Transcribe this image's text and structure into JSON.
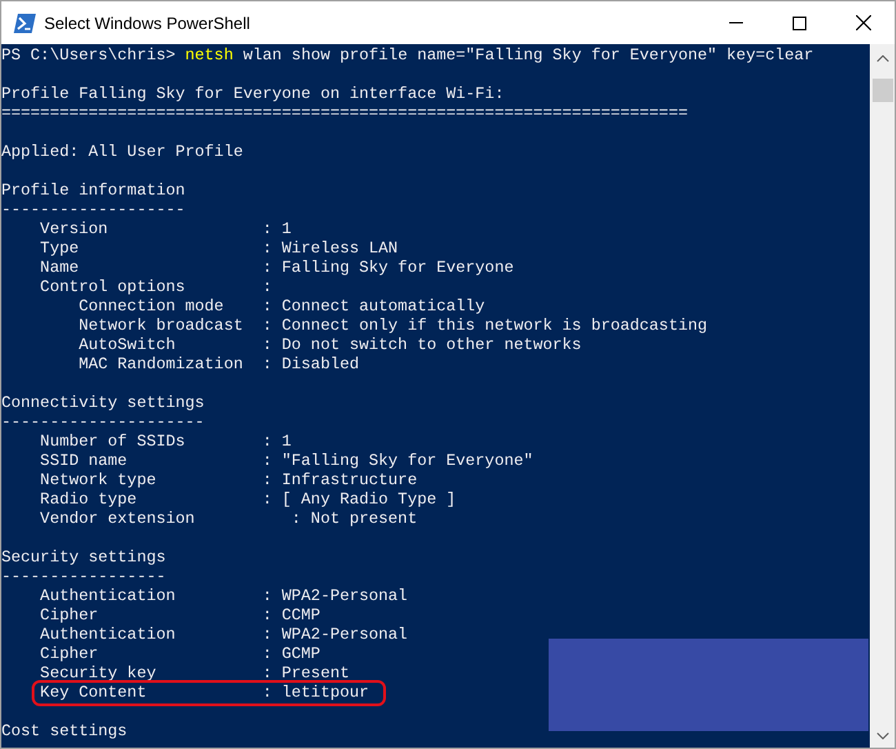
{
  "window": {
    "title": "Select Windows PowerShell"
  },
  "console": {
    "lines": [
      {
        "kind": "prompt",
        "prompt": "PS C:\\Users\\chris> ",
        "command": "netsh",
        "args": " wlan show profile name=\"Falling Sky for Everyone\" key=clear",
        "highlighted": false
      },
      {
        "kind": "blank"
      },
      {
        "kind": "output",
        "text": "Profile Falling Sky for Everyone on interface Wi-Fi:",
        "highlighted": false
      },
      {
        "kind": "output",
        "text": "=======================================================================",
        "highlighted": false
      },
      {
        "kind": "blank"
      },
      {
        "kind": "output",
        "text": "Applied: All User Profile",
        "highlighted": false
      },
      {
        "kind": "blank"
      },
      {
        "kind": "output",
        "text": "Profile information",
        "highlighted": false
      },
      {
        "kind": "output",
        "text": "-------------------",
        "highlighted": false
      },
      {
        "kind": "output",
        "text": "    Version                : 1",
        "highlighted": false
      },
      {
        "kind": "output",
        "text": "    Type                   : Wireless LAN",
        "highlighted": false
      },
      {
        "kind": "output",
        "text": "    Name                   : Falling Sky for Everyone",
        "highlighted": false
      },
      {
        "kind": "output",
        "text": "    Control options        :",
        "highlighted": false
      },
      {
        "kind": "output",
        "text": "        Connection mode    : Connect automatically",
        "highlighted": false
      },
      {
        "kind": "output",
        "text": "        Network broadcast  : Connect only if this network is broadcasting",
        "highlighted": false
      },
      {
        "kind": "output",
        "text": "        AutoSwitch         : Do not switch to other networks",
        "highlighted": false
      },
      {
        "kind": "output",
        "text": "        MAC Randomization  : Disabled",
        "highlighted": false
      },
      {
        "kind": "blank"
      },
      {
        "kind": "output",
        "text": "Connectivity settings",
        "highlighted": false
      },
      {
        "kind": "output",
        "text": "---------------------",
        "highlighted": false
      },
      {
        "kind": "output",
        "text": "    Number of SSIDs        : 1",
        "highlighted": false
      },
      {
        "kind": "output",
        "text": "    SSID name              : \"Falling Sky for Everyone\"",
        "highlighted": false
      },
      {
        "kind": "output",
        "text": "    Network type           : Infrastructure",
        "highlighted": false
      },
      {
        "kind": "output",
        "text": "    Radio type             : [ Any Radio Type ]",
        "highlighted": false
      },
      {
        "kind": "output",
        "text": "    Vendor extension          : Not present",
        "highlighted": false
      },
      {
        "kind": "blank"
      },
      {
        "kind": "output",
        "text": "Security settings",
        "highlighted": false
      },
      {
        "kind": "output",
        "text": "-----------------",
        "highlighted": false
      },
      {
        "kind": "output",
        "text": "    Authentication         : WPA2-Personal",
        "highlighted": false
      },
      {
        "kind": "output",
        "text": "    Cipher                 : CCMP",
        "highlighted": false
      },
      {
        "kind": "output",
        "text": "    Authentication         : WPA2-Personal",
        "highlighted": false
      },
      {
        "kind": "output",
        "text": "    Cipher                 : GCMP",
        "highlighted": false
      },
      {
        "kind": "output",
        "text": "    Security key           : Present",
        "highlighted": false
      },
      {
        "kind": "output",
        "text": "    Key Content            : letitpour",
        "highlighted": true
      },
      {
        "kind": "blank"
      },
      {
        "kind": "output",
        "text": "Cost settings",
        "highlighted": false
      }
    ]
  }
}
